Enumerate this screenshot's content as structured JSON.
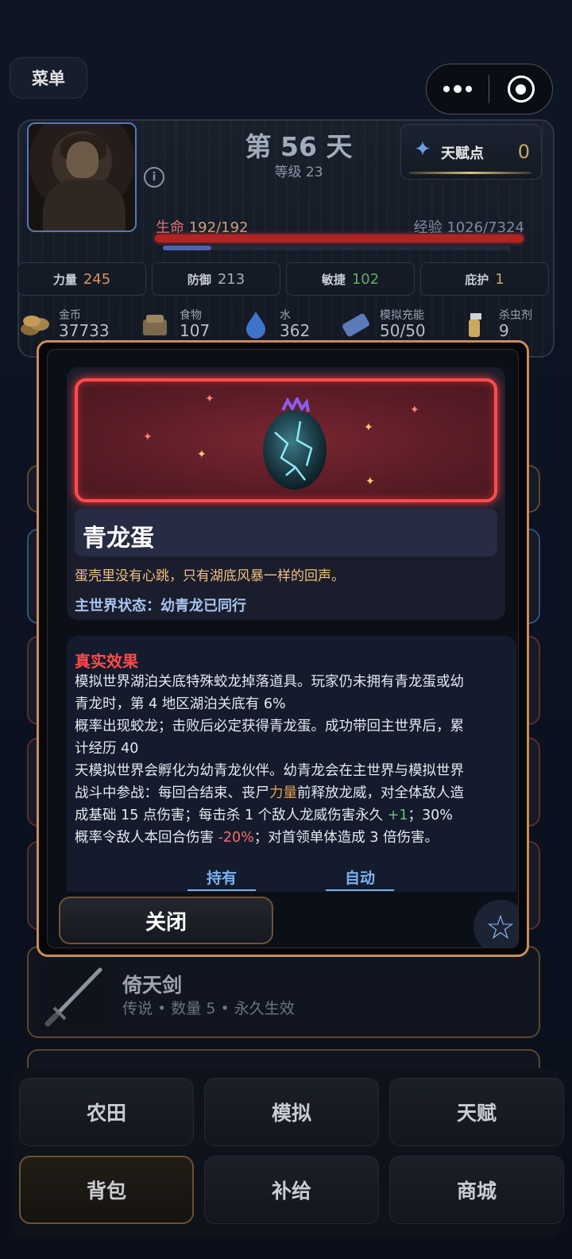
{
  "menu": {
    "label": "菜单"
  },
  "hud": {
    "day": "第 56 天",
    "level": "等级 23",
    "talent_label": "天赋点",
    "talent_value": "0",
    "hp_key": "生命",
    "hp_value": "192/192",
    "hp_fraction": 1.0,
    "xp_key": "经验",
    "xp_value": "1026/7324",
    "xp_fraction": 0.14
  },
  "stats": [
    {
      "label": "力量",
      "value": "245",
      "color": "#d8955a"
    },
    {
      "label": "防御",
      "value": "213",
      "color": "#a8aeb8"
    },
    {
      "label": "敏捷",
      "value": "102",
      "color": "#5fae68"
    },
    {
      "label": "庇护",
      "value": "1",
      "color": "#c9a862"
    }
  ],
  "resources": [
    {
      "label": "金币",
      "value": "37733",
      "icon": "coins-icon"
    },
    {
      "label": "食物",
      "value": "107",
      "icon": "food-icon"
    },
    {
      "label": "水",
      "value": "362",
      "icon": "water-drop-icon"
    },
    {
      "label": "模拟充能",
      "value": "50/50",
      "icon": "battery-icon"
    },
    {
      "label": "杀虫剂",
      "value": "9",
      "icon": "spray-bottle-icon"
    }
  ],
  "modal": {
    "item_name": "青龙蛋",
    "flavor": "蛋壳里没有心跳，只有湖底风暴一样的回声。",
    "status": "主世界状态：幼青龙已同行",
    "effect_title": "真实效果",
    "effect_lines": [
      "模拟世界湖泊关底特殊蛟龙掉落道具。玩家仍未拥有青龙蛋或幼",
      "青龙时，第 4 地区湖泊关底有 6%",
      "概率出现蛟龙；击败后必定获得青龙蛋。成功带回主世界后，累",
      "计经历 40",
      "天模拟世界会孵化为幼青龙伙伴。幼青龙会在主世界与模拟世界"
    ],
    "effect_l6_a": "战斗中参战：每回合结束、丧尸",
    "effect_l6_hl": "力量",
    "effect_l6_b": "前释放龙威，对全体敌人造",
    "effect_l7_a": "成基础 15 点伤害；每击杀 1 个敌人龙威伤害永久 ",
    "effect_l7_gn": "+1",
    "effect_l7_b": "；30%",
    "effect_l8_a": "概率令敌人本回合伤害 ",
    "effect_l8_rd": "-20%",
    "effect_l8_b": "；对首领单体造成 3 倍伤害。",
    "link_hold": "持有",
    "link_auto": "自动",
    "close_label": "关闭",
    "star_icon": "star-icon"
  },
  "background_item": {
    "name": "倚天剑",
    "meta": "传说 • 数量 5 • 永久生效",
    "icon": "sword-icon"
  },
  "tabs": [
    {
      "label": "农田",
      "active": false
    },
    {
      "label": "模拟",
      "active": false
    },
    {
      "label": "天赋",
      "active": false
    },
    {
      "label": "背包",
      "active": true
    },
    {
      "label": "补给",
      "active": false
    },
    {
      "label": "商城",
      "active": false
    }
  ]
}
